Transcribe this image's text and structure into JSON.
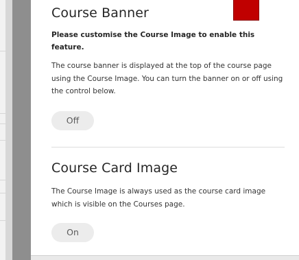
{
  "banner_section": {
    "title": "Course Banner",
    "warning": "Please customise the Course Image to enable this feature.",
    "description": "The course banner is displayed at the top of the course page using the Course Image. You can turn the banner on or off using the control below.",
    "toggle_label": "Off"
  },
  "card_section": {
    "title": "Course Card Image",
    "description": "The Course Image is always used as the course card image which is visible on the Courses page.",
    "toggle_label": "On"
  },
  "colors": {
    "swatch": "#c00000",
    "toggle_bg": "#ececec",
    "text": "#262626"
  }
}
